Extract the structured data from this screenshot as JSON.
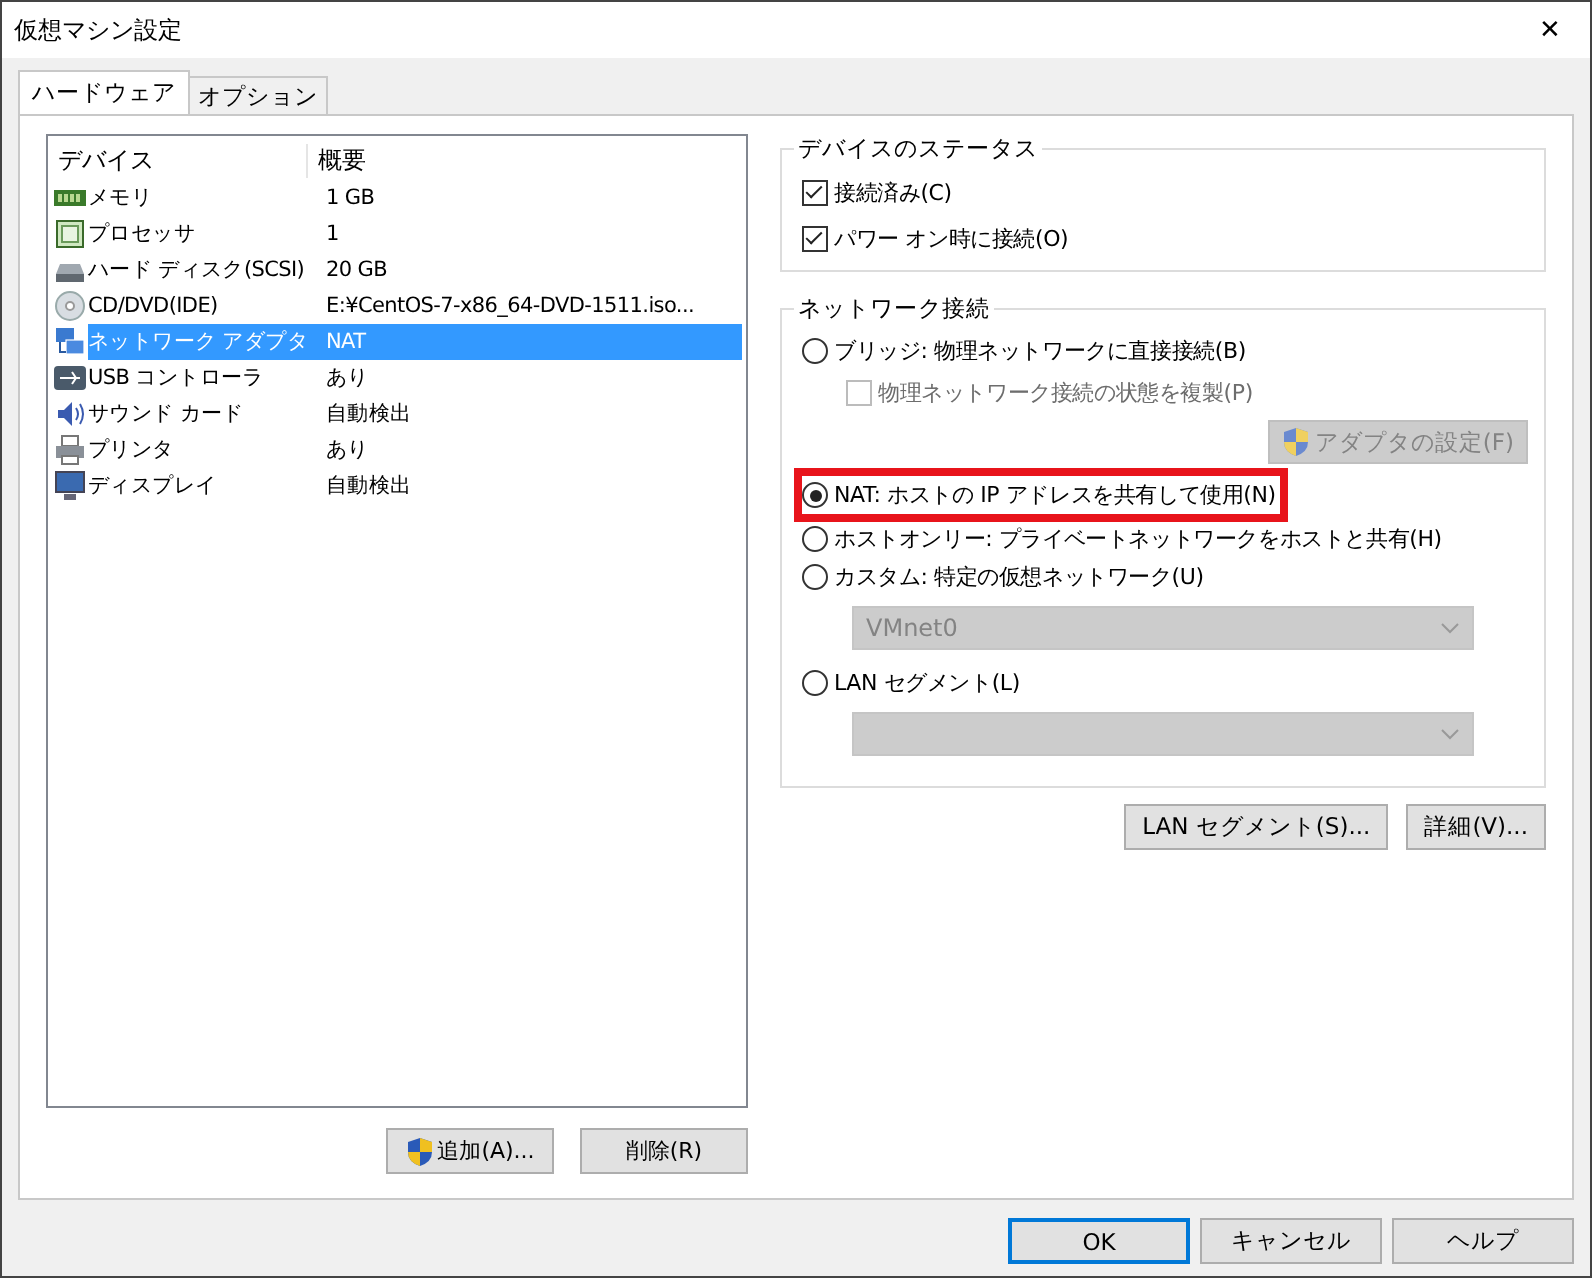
{
  "window": {
    "title": "仮想マシン設定",
    "close": "✕"
  },
  "tabs": [
    {
      "label": "ハードウェア",
      "selected": true
    },
    {
      "label": "オプション",
      "selected": false
    }
  ],
  "device_list": {
    "columns": [
      "デバイス",
      "概要"
    ],
    "rows": [
      {
        "kind": "memory",
        "device": "メモリ",
        "summary": "1 GB",
        "selected": false
      },
      {
        "kind": "cpu",
        "device": "プロセッサ",
        "summary": "1",
        "selected": false
      },
      {
        "kind": "disk",
        "device": "ハード ディスク(SCSI)",
        "summary": "20 GB",
        "selected": false
      },
      {
        "kind": "cd",
        "device": "CD/DVD(IDE)",
        "summary": "E:¥CentOS-7-x86_64-DVD-1511.iso...",
        "selected": false
      },
      {
        "kind": "network",
        "device": "ネットワーク アダプタ",
        "summary": "NAT",
        "selected": true
      },
      {
        "kind": "usb",
        "device": "USB コントローラ",
        "summary": "あり",
        "selected": false
      },
      {
        "kind": "sound",
        "device": "サウンド カード",
        "summary": "自動検出",
        "selected": false
      },
      {
        "kind": "printer",
        "device": "プリンタ",
        "summary": "あり",
        "selected": false
      },
      {
        "kind": "display",
        "device": "ディスプレイ",
        "summary": "自動検出",
        "selected": false
      }
    ],
    "buttons": [
      {
        "label": "追加(A)...",
        "shield": true
      },
      {
        "label": "削除(R)",
        "shield": false
      }
    ]
  },
  "device_status": {
    "title": "デバイスのステータス",
    "checkboxes": [
      {
        "label": "接続済み(C)",
        "checked": true
      },
      {
        "label": "パワー オン時に接続(O)",
        "checked": true
      }
    ]
  },
  "network_connection": {
    "title": "ネットワーク接続",
    "items": [
      {
        "kind": "radio",
        "label": "ブリッジ: 物理ネットワークに直接接続(B)",
        "selected": false,
        "highlighted": false
      },
      {
        "kind": "checkbox",
        "label": "物理ネットワーク接続の状態を複製(P)",
        "checked": false,
        "disabled": true
      },
      {
        "kind": "button",
        "label": "アダプタの設定(F)",
        "disabled": true
      },
      {
        "kind": "radio",
        "label": "NAT: ホストの IP アドレスを共有して使用(N)",
        "selected": true,
        "highlighted": true
      },
      {
        "kind": "radio",
        "label": "ホストオンリー: プライベートネットワークをホストと共有(H)",
        "selected": false,
        "highlighted": false
      },
      {
        "kind": "radio",
        "label": "カスタム: 特定の仮想ネットワーク(U)",
        "selected": false,
        "highlighted": false
      },
      {
        "kind": "dropdown",
        "value": "VMnet0",
        "disabled": true
      },
      {
        "kind": "radio",
        "label": "LAN セグメント(L)",
        "selected": false,
        "highlighted": false
      },
      {
        "kind": "dropdown",
        "disabled": true
      }
    ]
  },
  "network_buttons": [
    "LAN セグメント(S)...",
    "詳細(V)..."
  ],
  "dialog_buttons": [
    {
      "label": "OK",
      "default": true
    },
    {
      "label": "キャンセル",
      "default": false
    },
    {
      "label": "ヘルプ",
      "default": false
    }
  ]
}
